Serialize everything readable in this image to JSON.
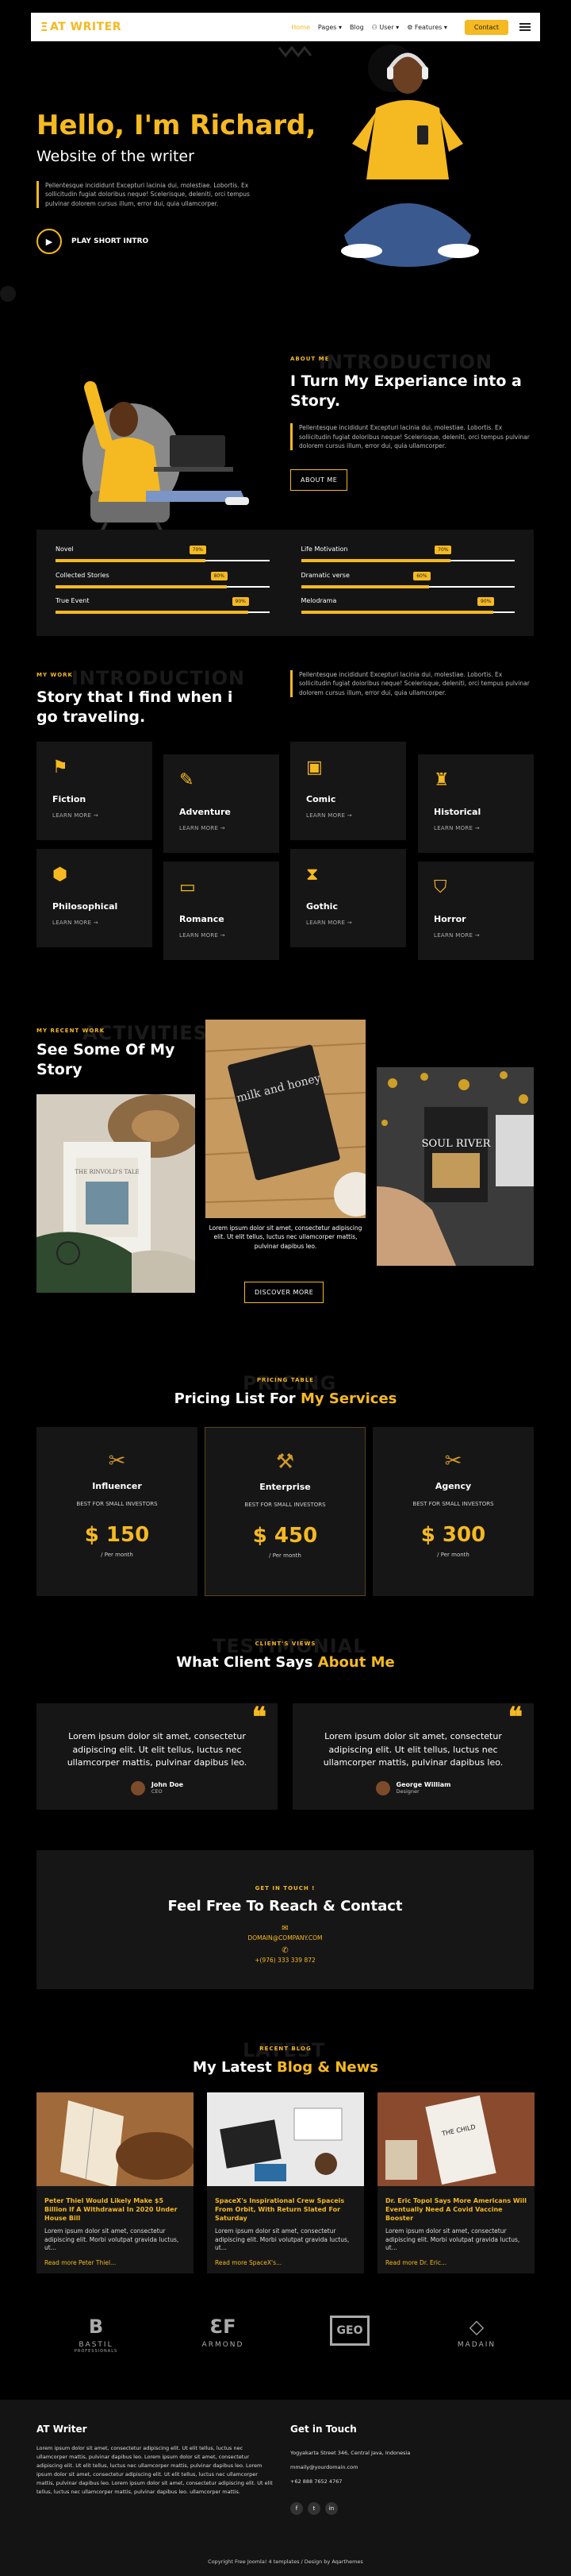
{
  "brand": {
    "name": "AT WRITER",
    "mark": "Ξ"
  },
  "nav": {
    "items": [
      "Home",
      "Pages ▾",
      "Blog",
      "User ▾",
      "Features ▾"
    ],
    "contact": "Contact"
  },
  "hero": {
    "greeting": "Hello, I'm Richard,",
    "subtitle": "Website of the writer",
    "text": "Pellentesque incididunt Excepturi lacinia dui, molestiae. Lobortis. Ex sollicitudin fugiat doloribus neque! Scelerisque, deleniti, orci tempus pulvinar dolorem cursus illum, error dui, quia ullamcorper.",
    "play_label": "PLAY SHORT INTRO"
  },
  "intro": {
    "tag": "ABOUT ME",
    "ghost": "INTRODUCTION",
    "title": "I Turn My Experiance into a Story.",
    "text": "Pellentesque incididunt Excepturi lacinia dui, molestiae. Lobortis. Ex sollicitudin fugiat doloribus neque! Scelerisque, deleniti, orci tempus pulvinar dolorem cursus illum, error dui, quia ullamcorper.",
    "button": "ABOUT ME"
  },
  "skills": [
    {
      "label": "Novel",
      "pct": "70%",
      "value": 0.7
    },
    {
      "label": "Life Motivation",
      "pct": "70%",
      "value": 0.7
    },
    {
      "label": "Collected Stories",
      "pct": "80%",
      "value": 0.8
    },
    {
      "label": "Dramatic verse",
      "pct": "60%",
      "value": 0.6
    },
    {
      "label": "True Event",
      "pct": "90%",
      "value": 0.9
    },
    {
      "label": "Melodrama",
      "pct": "90%",
      "value": 0.9
    }
  ],
  "story": {
    "tag": "MY WORK",
    "ghost": "INTRODUCTION",
    "title": "Story that I find when i go traveling.",
    "text": "Pellentesque incididunt Excepturi lacinia dui, molestiae. Lobortis. Ex sollicitudin fugiat doloribus neque! Scelerisque, deleniti, orci tempus pulvinar dolorem cursus illum, error dui, quia ullamcorper."
  },
  "categories": [
    {
      "name": "Fiction",
      "more": "LEARN MORE →",
      "icon": "flag-icon",
      "glyph": "⚑"
    },
    {
      "name": "Adventure",
      "more": "LEARN MORE →",
      "icon": "compass-icon",
      "glyph": "✎"
    },
    {
      "name": "Comic",
      "more": "LEARN MORE →",
      "icon": "images-icon",
      "glyph": "▣"
    },
    {
      "name": "Historical",
      "more": "LEARN MORE →",
      "icon": "castle-icon",
      "glyph": "♜"
    },
    {
      "name": "Philosophical",
      "more": "LEARN MORE →",
      "icon": "cube-icon",
      "glyph": "⬢"
    },
    {
      "name": "Romance",
      "more": "LEARN MORE →",
      "icon": "laptop-icon",
      "glyph": "▭"
    },
    {
      "name": "Gothic",
      "more": "LEARN MORE →",
      "icon": "hourglass-icon",
      "glyph": "⧗"
    },
    {
      "name": "Horror",
      "more": "LEARN MORE →",
      "icon": "shield-icon",
      "glyph": "⛉"
    }
  ],
  "recent": {
    "tag": "MY RECENT WORK",
    "ghost": "ACTIVITIES",
    "title": "See Some Of My Story",
    "caption": "Lorem ipsum dolor sit amet, consectetur adipiscing elit. Ut elit tellus, luctus nec ullamcorper mattis, pulvinar dapibus leo.",
    "button": "DISCOVER MORE",
    "book1": "THE RINVOLD'S TALE",
    "book2": "milk and honey",
    "book3": "SOUL RIVER"
  },
  "pricing": {
    "tag": "PRICING TABLE",
    "ghost": "PRICING",
    "title_a": "Pricing List For ",
    "title_b": "My Services",
    "plans": [
      {
        "name": "Influencer",
        "sub": "BEST FOR SMALL INVESTORS",
        "amount": "$ 150",
        "per": "/ Per month"
      },
      {
        "name": "Enterprise",
        "sub": "BEST FOR SMALL INVESTORS",
        "amount": "$ 450",
        "per": "/ Per month"
      },
      {
        "name": "Agency",
        "sub": "BEST FOR SMALL INVESTORS",
        "amount": "$ 300",
        "per": "/ Per month"
      }
    ]
  },
  "testimonials": {
    "tag": "CLIENT'S VIEWS",
    "ghost": "TESTIMONIAL",
    "title_a": "What Client Says ",
    "title_b": "About Me",
    "items": [
      {
        "text": "Lorem ipsum dolor sit amet, consectetur adipiscing elit. Ut elit tellus, luctus nec ullamcorper mattis, pulvinar dapibus leo.",
        "name": "John Doe",
        "role": "CEO"
      },
      {
        "text": "Lorem ipsum dolor sit amet, consectetur adipiscing elit. Ut elit tellus, luctus nec ullamcorper mattis, pulvinar dapibus leo.",
        "name": "George William",
        "role": "Designer"
      }
    ]
  },
  "contact": {
    "tag": "GET IN TOUCH !",
    "title": "Feel Free To Reach & Contact",
    "email": "DOMAIN@COMPANY.COM",
    "phone": "+(976) 333 339 872"
  },
  "blog": {
    "tag": "RECENT BLOG",
    "ghost": "LATEST",
    "title_a": "My Latest ",
    "title_b": "Blog & News",
    "posts": [
      {
        "title": "Peter Thiel Would Likely Make $5 Billion If A Withdrawal In 2020 Under House Bill",
        "excerpt": "Lorem ipsum dolor sit amet, consectetur adipiscing elit. Morbi volutpat gravida luctus, ut...",
        "more": "Read more Peter Thiel..."
      },
      {
        "title": "SpaceX's Inspirational Crew Spaceis From Orbit, With Return Slated For Saturday",
        "excerpt": "Lorem ipsum dolor sit amet, consectetur adipiscing elit. Morbi volutpat gravida luctus, ut...",
        "more": "Read more SpaceX's..."
      },
      {
        "title": "Dr. Eric Topol Says More Americans Will Eventually Need A Covid Vaccine Booster",
        "excerpt": "Lorem ipsum dolor sit amet, consectetur adipiscing elit. Morbi volutpat gravida luctus, ut...",
        "more": "Read more Dr. Eric..."
      }
    ]
  },
  "partners": [
    {
      "name": "BASTIL",
      "sub": "PROFESSIONALS",
      "glyph": "B"
    },
    {
      "name": "ARMOND",
      "sub": "",
      "glyph": "ƐF"
    },
    {
      "name": "",
      "sub": "",
      "glyph": "GEO"
    },
    {
      "name": "MADAIN",
      "sub": "",
      "glyph": "◇"
    }
  ],
  "footer": {
    "title": "AT Writer",
    "text": "Lorem ipsum dolor sit amet, consectetur adipiscing elit. Ut elit tellus, luctus nec ullamcorper mattis, pulvinar dapibus leo. Lorem ipsum dolor sit amet, consectetur adipiscing elit. Ut elit tellus, luctus nec ullamcorper mattis, pulvinar dapibus leo. Lorem ipsum dolor sit amet, consectetur adipiscing elit. Ut elit tellus, luctus nec ullamcorper mattis, pulvinar dapibus leo. Lorem ipsum dolor sit amet, consectetur adipiscing elit. Ut elit tellus, luctus nec ullamcorper mattis, pulvinar dapibus leo. ullamcorper mattis.",
    "contact_title": "Get in Touch",
    "address": "Yogyakarta Street 346, Central Java, Indonesia",
    "email": "mmaily@yourdomain.com",
    "phone": "+62 888 7652 4767",
    "social": [
      "f",
      "t",
      "in"
    ],
    "copyright": "Copyright Free Joomla! 4 templates / Design by Aqarthemes"
  },
  "colors": {
    "accent": "#f5b921",
    "bg": "#000000",
    "card": "#161616"
  }
}
